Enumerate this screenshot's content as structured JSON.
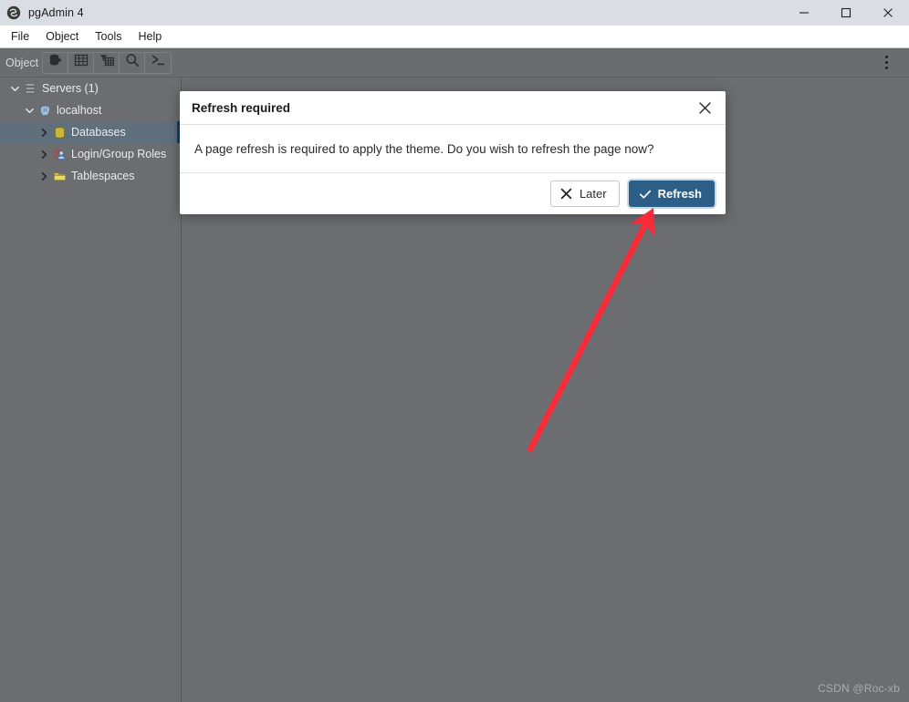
{
  "window": {
    "title": "pgAdmin 4",
    "app_icon": "pgadmin-elephant-icon",
    "controls": {
      "minimize": "minimize-icon",
      "maximize": "maximize-icon",
      "close": "close-icon"
    }
  },
  "menubar": {
    "items": [
      {
        "label": "File"
      },
      {
        "label": "Object"
      },
      {
        "label": "Tools"
      },
      {
        "label": "Help"
      }
    ]
  },
  "toolbar": {
    "label": "Object",
    "buttons": [
      {
        "name": "query-tool-button",
        "icon": "database-play-icon"
      },
      {
        "name": "view-data-button",
        "icon": "table-grid-icon"
      },
      {
        "name": "filtered-rows-button",
        "icon": "filter-table-icon"
      },
      {
        "name": "search-objects-button",
        "icon": "search-icon"
      },
      {
        "name": "psql-tool-button",
        "icon": "terminal-icon"
      }
    ],
    "overflow_menu": "kebab-menu-icon"
  },
  "sidebar": {
    "tree": [
      {
        "label": "Servers (1)",
        "icon": "servers-icon",
        "indent": 0,
        "expanded": true,
        "selected": false
      },
      {
        "label": "localhost",
        "icon": "postgres-server-icon",
        "indent": 1,
        "expanded": true,
        "selected": false
      },
      {
        "label": "Databases",
        "icon": "databases-icon",
        "indent": 2,
        "expanded": false,
        "selected": true
      },
      {
        "label": "Login/Group Roles",
        "icon": "roles-icon",
        "indent": 2,
        "expanded": false,
        "selected": false
      },
      {
        "label": "Tablespaces",
        "icon": "tablespaces-icon",
        "indent": 2,
        "expanded": false,
        "selected": false
      }
    ]
  },
  "dialog": {
    "title": "Refresh required",
    "message": "A page refresh is required to apply the theme. Do you wish to refresh the page now?",
    "close_icon": "close-icon",
    "buttons": {
      "later": {
        "label": "Later",
        "icon": "cross-icon"
      },
      "refresh": {
        "label": "Refresh",
        "icon": "check-icon"
      }
    }
  },
  "annotation": {
    "arrow_color": "#f92b38",
    "arrow_from": "580,495",
    "arrow_to": "716,224"
  },
  "watermark": {
    "text": "CSDN @Roc-xb"
  },
  "colors": {
    "titlebar_bg": "#dadde1",
    "menubar_bg": "#ffffff",
    "toolbar_bg": "#6a6c70",
    "content_bg": "#6b6d71",
    "tree_selected_bg": "#5f6f7c",
    "primary_button_bg": "#2c5f87",
    "dialog_bg": "#ffffff"
  }
}
